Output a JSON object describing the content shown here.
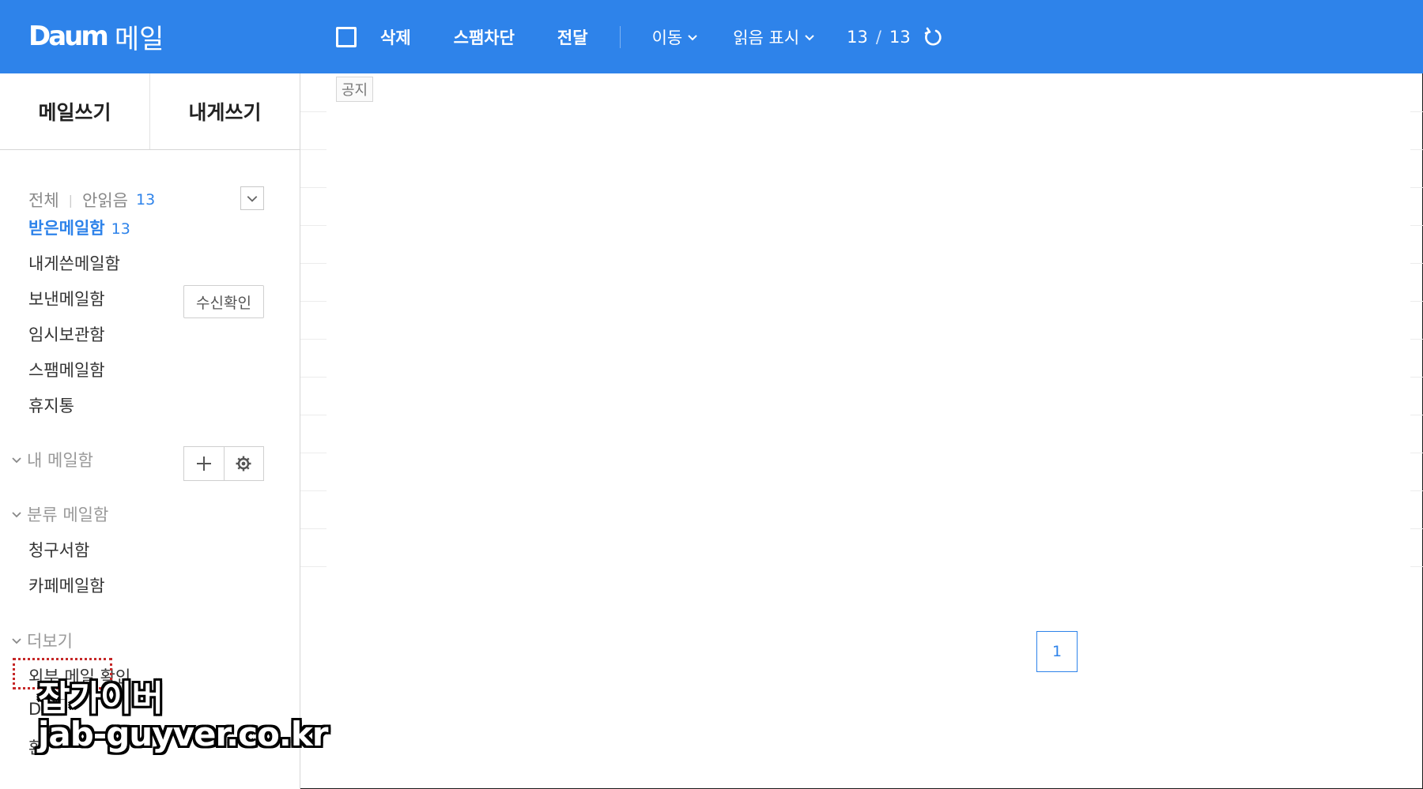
{
  "header": {
    "logo_mark": "Daum",
    "logo_text": "메일",
    "toolbar": {
      "delete_label": "삭제",
      "spam_block_label": "스팸차단",
      "forward_label": "전달",
      "move_label": "이동",
      "mark_read_label": "읽음 표시",
      "count_current": "13",
      "count_separator": "/",
      "count_total": "13"
    }
  },
  "sidebar": {
    "compose_label": "메일쓰기",
    "self_compose_label": "내게쓰기",
    "filter": {
      "all_label": "전체",
      "separator": "|",
      "unread_label": "안읽음",
      "unread_count": "13"
    },
    "folders": [
      {
        "label": "받은메일함",
        "count": "13",
        "active": true
      },
      {
        "label": "내게쓴메일함"
      },
      {
        "label": "보낸메일함"
      },
      {
        "label": "임시보관함"
      },
      {
        "label": "스팸메일함"
      },
      {
        "label": "휴지통"
      }
    ],
    "receipt_check_label": "수신확인",
    "my_mailbox_label": "내 메일함",
    "category_label": "분류 메일함",
    "category_folders": [
      {
        "label": "청구서함"
      },
      {
        "label": "카페메일함"
      }
    ],
    "more_label": "더보기",
    "more_items": [
      {
        "label": "외부 메일 확인"
      },
      {
        "label": "D"
      },
      {
        "label": "환"
      }
    ]
  },
  "main": {
    "notice_label": "공지",
    "page_current": "1"
  },
  "watermark": {
    "line1": "잡가이버",
    "line2": "jab-guyver.co.kr"
  },
  "colors": {
    "brand_blue": "#2e83ea",
    "highlight_red": "#c62828"
  }
}
